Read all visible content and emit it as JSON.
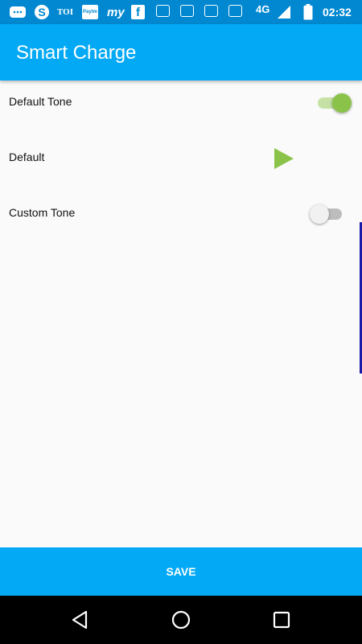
{
  "status_bar": {
    "time": "02:32",
    "network": "4G",
    "notification_icons": [
      "chat-icon",
      "skype-icon",
      "toi-icon",
      "paytm-icon",
      "myntra-icon",
      "facebook-icon",
      "app-icon",
      "app-icon",
      "app-icon",
      "app-icon"
    ],
    "toi_label": "TOI",
    "paytm_label": "Paytm",
    "myntra_label": "my",
    "facebook_label": "f",
    "skype_label": "S"
  },
  "app_bar": {
    "title": "Smart Charge"
  },
  "settings": {
    "default_tone": {
      "label": "Default Tone",
      "enabled": true
    },
    "default_item": {
      "label": "Default",
      "icon": "play-icon"
    },
    "custom_tone": {
      "label": "Custom Tone",
      "enabled": false
    }
  },
  "save_button": {
    "label": "SAVE"
  },
  "colors": {
    "status_bar": "#0288d1",
    "app_bar": "#03a9f4",
    "accent": "#8bc34a",
    "background": "#fafafa"
  }
}
